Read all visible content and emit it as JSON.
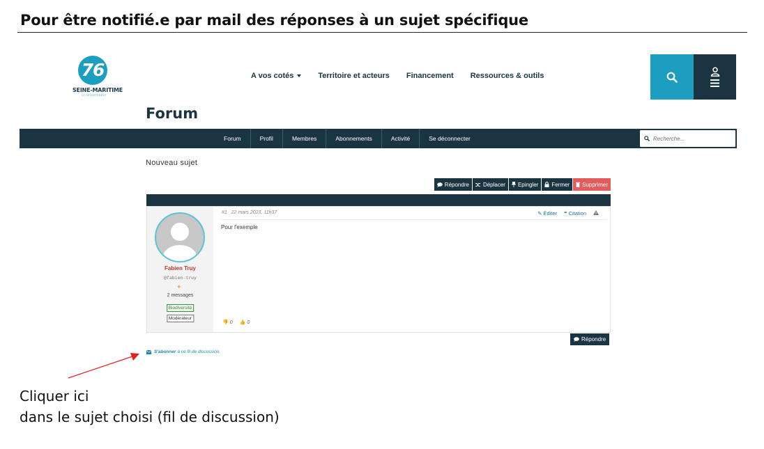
{
  "doc": {
    "title": "Pour être notifié.e par mail des réponses à un sujet spécifique",
    "callout_line1": "Cliquer ici",
    "callout_line2": "dans le sujet choisi (fil de discussion)"
  },
  "header": {
    "logo_number": "76",
    "logo_text": "SEINE-MARITIME",
    "logo_sub": "LE DÉPARTEMENT",
    "nav": [
      "A vos cotés",
      "Territoire et acteurs",
      "Financement",
      "Ressources & outils"
    ]
  },
  "forum": {
    "heading": "Forum",
    "nav": [
      "Forum",
      "Profil",
      "Membres",
      "Abonnements",
      "Activité",
      "Se déconnecter"
    ],
    "search_placeholder": "Recherche..."
  },
  "topic": {
    "title": "Nouveau sujet",
    "actions": {
      "reply": "Répondre",
      "move": "Déplacer",
      "pin": "Epingler",
      "close": "Fermer",
      "delete": "Supprimer"
    },
    "post": {
      "number": "#1",
      "date": "22 mars 2023, 11h37",
      "edit": "Éditer",
      "quote": "Citation",
      "body": "Pour l'exemple",
      "author": {
        "name": "Fabien Truy",
        "handle": "@fabien-truy",
        "messages": "2 messages",
        "badge1": "Biodiversité",
        "badge2": "Modérateur"
      },
      "downvotes": "0",
      "upvotes": "0"
    },
    "reply_bottom": "Répondre",
    "subscribe_bold": "S'abonner",
    "subscribe_rest": " à ce fil de discussion."
  },
  "colors": {
    "navy": "#1b3442",
    "teal": "#1b9ec0",
    "danger": "#e25c5c",
    "arrow": "#e02020"
  }
}
